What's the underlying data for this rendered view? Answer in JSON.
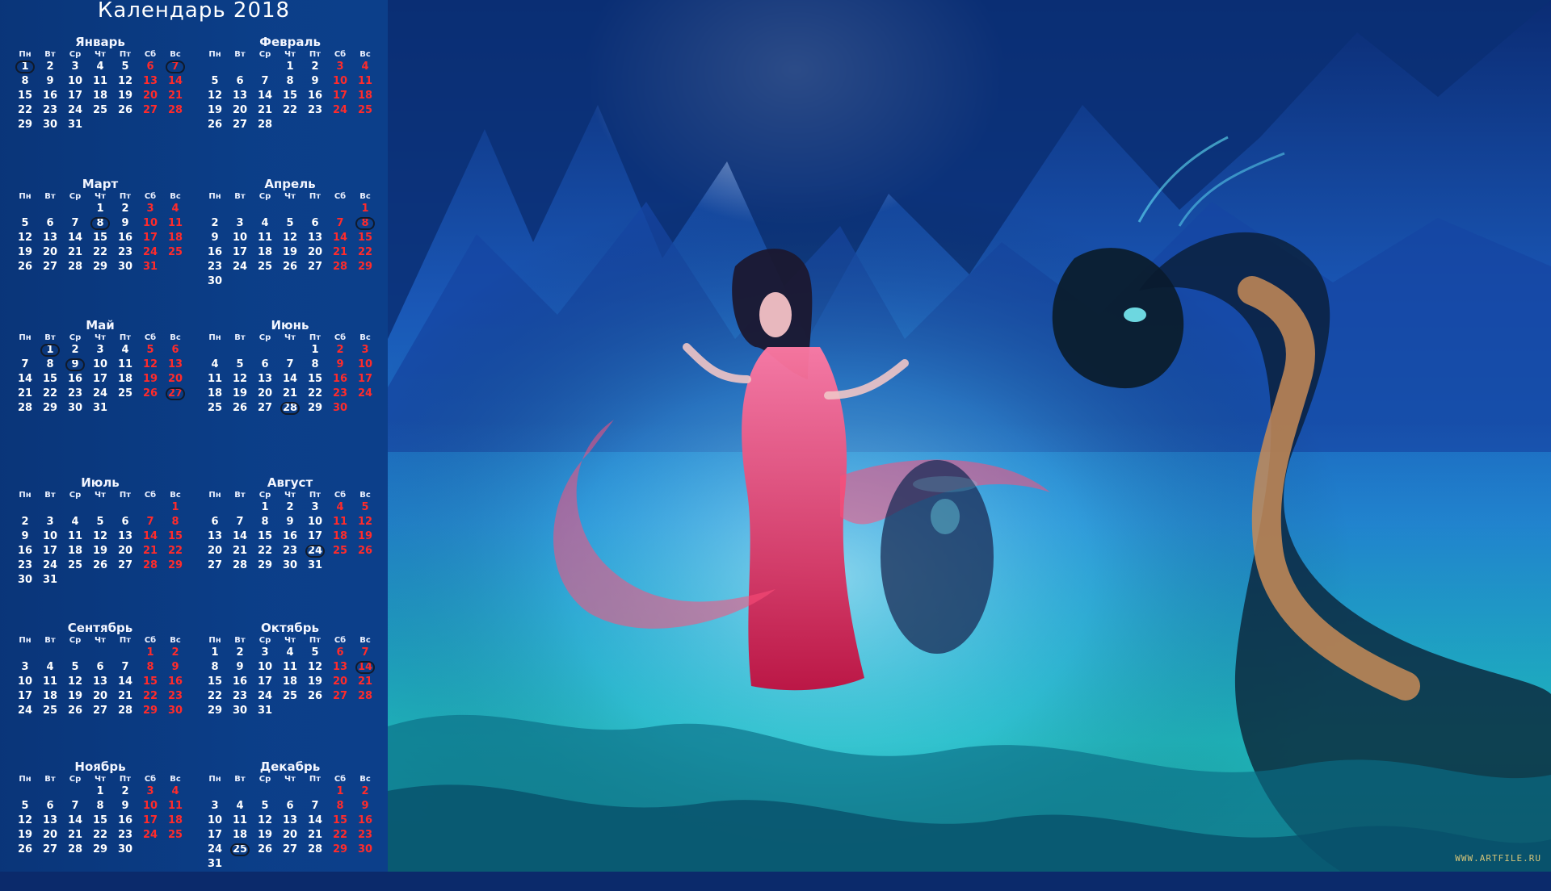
{
  "calendar": {
    "title": "Календарь 2018",
    "weekdays": [
      "Пн",
      "Вт",
      "Ср",
      "Чт",
      "Пт",
      "Сб",
      "Вс"
    ],
    "months": [
      {
        "name": "Январь",
        "start": 0,
        "days": 31,
        "marked": [
          1,
          7
        ]
      },
      {
        "name": "Февраль",
        "start": 3,
        "days": 28,
        "marked": []
      },
      {
        "name": "Март",
        "start": 3,
        "days": 31,
        "marked": [
          8
        ]
      },
      {
        "name": "Апрель",
        "start": 6,
        "days": 30,
        "marked": [
          8
        ]
      },
      {
        "name": "Май",
        "start": 1,
        "days": 31,
        "marked": [
          1,
          9,
          27
        ]
      },
      {
        "name": "Июнь",
        "start": 4,
        "days": 30,
        "marked": [
          28
        ]
      },
      {
        "name": "Июль",
        "start": 6,
        "days": 31,
        "marked": []
      },
      {
        "name": "Август",
        "start": 2,
        "days": 31,
        "marked": [
          24
        ]
      },
      {
        "name": "Сентябрь",
        "start": 5,
        "days": 30,
        "marked": []
      },
      {
        "name": "Октябрь",
        "start": 0,
        "days": 31,
        "marked": [
          14
        ]
      },
      {
        "name": "Ноябрь",
        "start": 3,
        "days": 30,
        "marked": []
      },
      {
        "name": "Декабрь",
        "start": 5,
        "days": 31,
        "marked": [
          25
        ]
      }
    ]
  },
  "artwork": {
    "description_icon": "fantasy-artwork",
    "watermark": "WWW.ARTFILE.RU"
  },
  "colors": {
    "panel": "#0c3f8a",
    "weekend": "#ff2b2b",
    "text": "#ffffff"
  }
}
